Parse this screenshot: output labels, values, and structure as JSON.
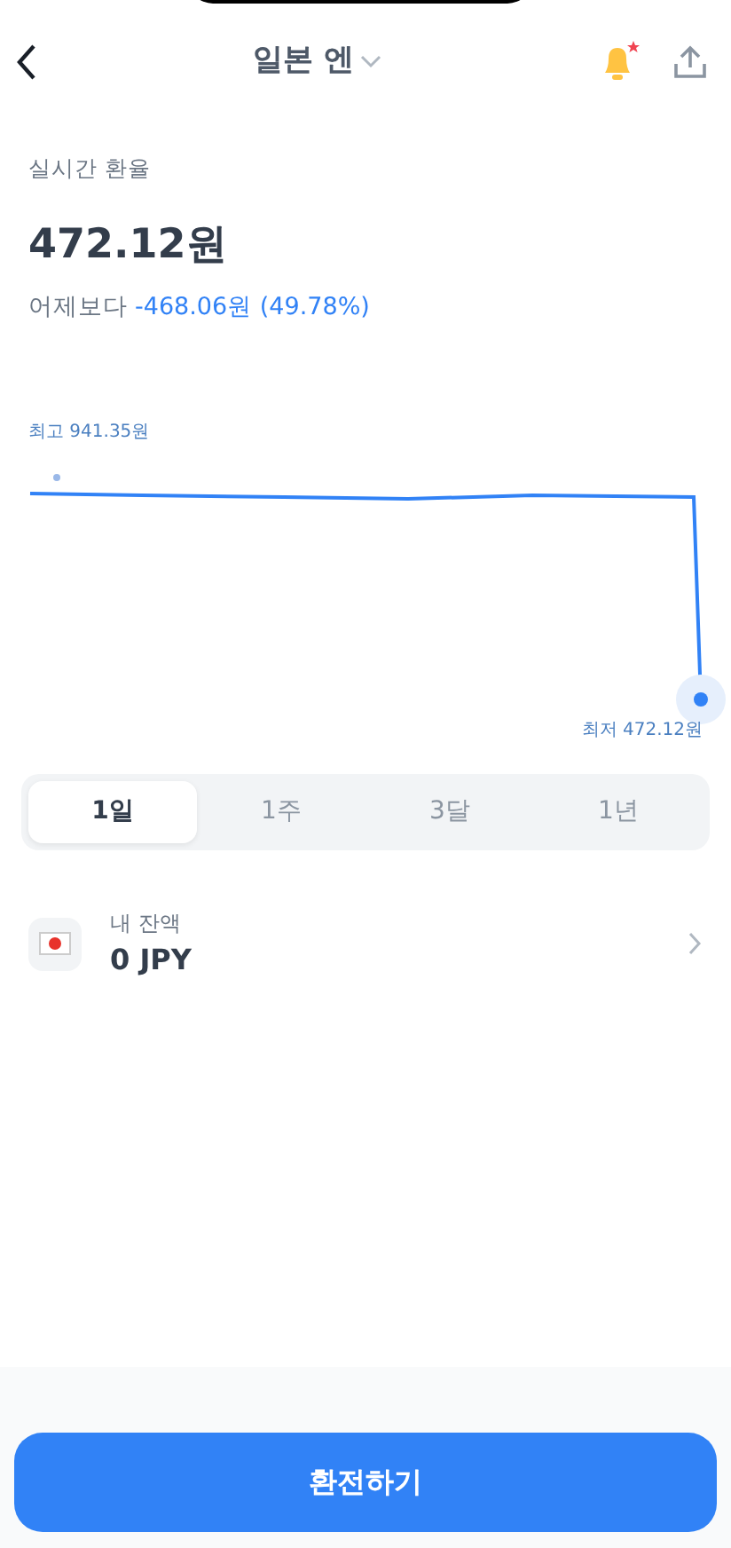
{
  "header": {
    "title": "일본 엔",
    "alert_on": true
  },
  "rate": {
    "label": "실시간 환율",
    "value": "472.12원",
    "change_prefix": "어제보다",
    "change": "-468.06원 (49.78%)"
  },
  "chart": {
    "high_label": "최고 941.35원",
    "low_label": "최저 472.12원"
  },
  "periods": [
    {
      "label": "1일",
      "selected": true
    },
    {
      "label": "1주",
      "selected": false
    },
    {
      "label": "3달",
      "selected": false
    },
    {
      "label": "1년",
      "selected": false
    }
  ],
  "balance": {
    "label": "내 잔액",
    "amount": "0 JPY"
  },
  "action": {
    "label": "환전하기"
  }
}
